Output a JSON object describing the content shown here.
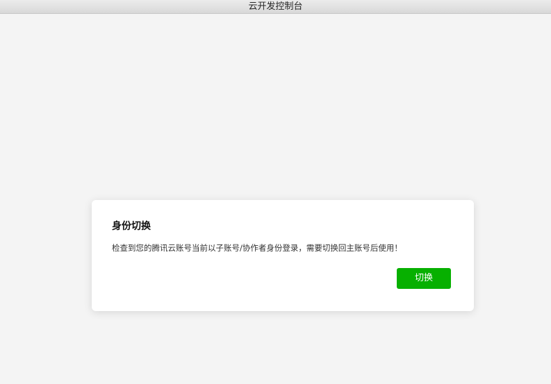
{
  "window": {
    "title": "云开发控制台"
  },
  "dialog": {
    "title": "身份切换",
    "message": "检查到您的腾讯云账号当前以子账号/协作者身份登录，需要切换回主账号后使用！",
    "switch_label": "切换"
  },
  "colors": {
    "background": "#f4f4f4",
    "dialog_background": "#ffffff",
    "primary_button": "#07b000",
    "button_text": "#ffffff"
  }
}
